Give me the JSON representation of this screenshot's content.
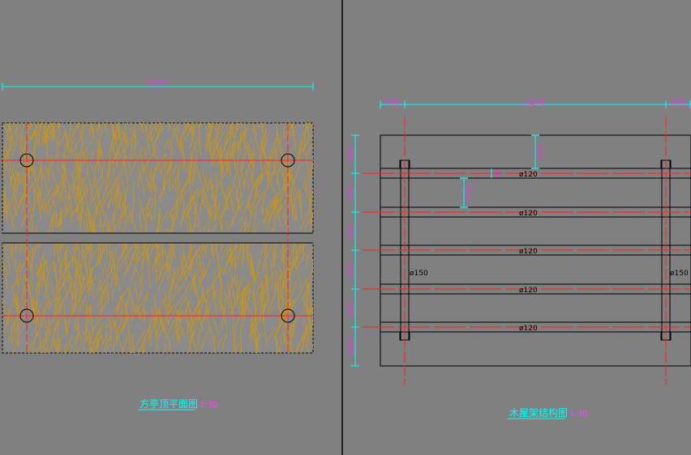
{
  "left_drawing": {
    "overall_dimension": "5000",
    "caption": "方亭顶平面图",
    "scale": "1:30"
  },
  "right_drawing": {
    "top_dimensions": [
      "400",
      "4200",
      "400"
    ],
    "vertical_dimensions": [
      "600",
      "625",
      "625",
      "625",
      "625",
      "600"
    ],
    "inner_dimensions": [
      "505",
      "80",
      "475"
    ],
    "rail_labels": [
      "ø120",
      "ø120",
      "ø120",
      "ø120",
      "ø120"
    ],
    "post_label_left": "ø150",
    "post_label_right": "ø150",
    "caption": "木屋架结构图",
    "scale": "1:30"
  },
  "colors": {
    "background": "#808080",
    "thatch": "#c8961e",
    "centerline": "#ff2020",
    "dimension": "#00ffff",
    "dimension_text": "#e040e0",
    "outline": "#000000"
  }
}
